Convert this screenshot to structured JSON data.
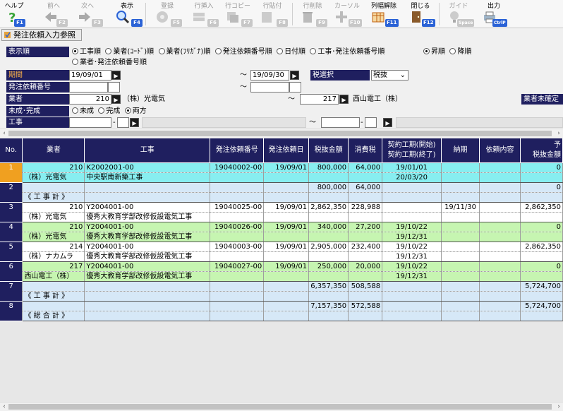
{
  "toolbar": {
    "buttons": [
      {
        "label": "ヘルプ",
        "key": "F1"
      },
      {
        "label": "前へ",
        "key": "F2"
      },
      {
        "label": "次へ",
        "key": "F3"
      },
      {
        "label": "表示",
        "key": "F4"
      },
      {
        "label": "登録",
        "key": "F5"
      },
      {
        "label": "行挿入",
        "key": "F6"
      },
      {
        "label": "行コピー",
        "key": "F7"
      },
      {
        "label": "行貼付",
        "key": "F8"
      },
      {
        "label": "行削除",
        "key": "F9"
      },
      {
        "label": "カーソル",
        "key": "F10"
      },
      {
        "label": "列幅解除",
        "key": "F11"
      },
      {
        "label": "閉じる",
        "key": "F12"
      },
      {
        "label": "ガイド",
        "key": "Space"
      },
      {
        "label": "出力",
        "key": "CtrlP"
      }
    ]
  },
  "title_tab": "発注依頼入力参照",
  "form": {
    "sort_label": "表示順",
    "sort_options": [
      "工事順",
      "業者(ｺｰﾄﾞ)順",
      "業者(ﾌﾘｶﾞﾅ)順",
      "発注依頼番号順",
      "日付順",
      "工事･発注依頼番号順",
      "業者･発注依頼番号順"
    ],
    "order_options": [
      "昇順",
      "降順"
    ],
    "period_label": "期間",
    "period_from": "19/09/01",
    "period_to": "19/09/30",
    "tilde": "～",
    "tax_label": "税選択",
    "tax_value": "税抜",
    "req_no_label": "発注依頼番号",
    "vendor_label": "業者",
    "vendor_from_code": "210",
    "vendor_from_name": "（株）光電気",
    "vendor_to_code": "217",
    "vendor_to_name": "西山電工（株）",
    "vendor_unconfirmed": "業者未確定",
    "status_label": "未成･完成",
    "status_options": [
      "未成",
      "完成",
      "両方"
    ],
    "work_label": "工事",
    "dash": "-"
  },
  "grid": {
    "headers": [
      "No.",
      "業者",
      "工事",
      "発注依頼番号",
      "発注依頼日",
      "税抜金額",
      "消費税",
      "契約工期(開始)",
      "契約工期(終了)",
      "納期",
      "依頼内容",
      "税抜金額",
      "予"
    ],
    "rows": [
      {
        "no": "1",
        "code": "210",
        "vendor": "（株）光電気",
        "work_code": "K2002001-00",
        "work_name": "中央駅南新築工事",
        "req_no": "19040002-00",
        "req_date": "19/09/01",
        "amount": "800,000",
        "tax": "64,000",
        "start": "19/01/01",
        "end": "20/03/20",
        "due": "",
        "content": "",
        "amount2": "0"
      },
      {
        "no": "2",
        "code": "",
        "vendor": "《 工 事 計 》",
        "work_code": "",
        "work_name": "",
        "req_no": "",
        "req_date": "",
        "amount": "800,000",
        "tax": "64,000",
        "start": "",
        "end": "",
        "due": "",
        "content": "",
        "amount2": "0"
      },
      {
        "no": "3",
        "code": "210",
        "vendor": "（株）光電気",
        "work_code": "Y2004001-00",
        "work_name": "優秀大教育学部改修仮設電気工事",
        "req_no": "19040025-00",
        "req_date": "19/09/01",
        "amount": "2,862,350",
        "tax": "228,988",
        "start": "",
        "end": "",
        "due": "19/11/30",
        "content": "",
        "amount2": "2,862,350"
      },
      {
        "no": "4",
        "code": "210",
        "vendor": "（株）光電気",
        "work_code": "Y2004001-00",
        "work_name": "優秀大教育学部改修仮設電気工事",
        "req_no": "19040026-00",
        "req_date": "19/09/01",
        "amount": "340,000",
        "tax": "27,200",
        "start": "19/10/22",
        "end": "19/12/31",
        "due": "",
        "content": "",
        "amount2": "0"
      },
      {
        "no": "5",
        "code": "214",
        "vendor": "（株）ナカムラ",
        "work_code": "Y2004001-00",
        "work_name": "優秀大教育学部改修仮設電気工事",
        "req_no": "19040003-00",
        "req_date": "19/09/01",
        "amount": "2,905,000",
        "tax": "232,400",
        "start": "19/10/22",
        "end": "19/12/31",
        "due": "",
        "content": "",
        "amount2": "2,862,350"
      },
      {
        "no": "6",
        "code": "217",
        "vendor": "西山電工（株）",
        "work_code": "Y2004001-00",
        "work_name": "優秀大教育学部改修仮設電気工事",
        "req_no": "19040027-00",
        "req_date": "19/09/01",
        "amount": "250,000",
        "tax": "20,000",
        "start": "19/10/22",
        "end": "19/12/31",
        "due": "",
        "content": "",
        "amount2": "0"
      },
      {
        "no": "7",
        "code": "",
        "vendor": "《 工 事 計 》",
        "work_code": "",
        "work_name": "",
        "req_no": "",
        "req_date": "",
        "amount": "6,357,350",
        "tax": "508,588",
        "start": "",
        "end": "",
        "due": "",
        "content": "",
        "amount2": "5,724,700"
      },
      {
        "no": "8",
        "code": "",
        "vendor": "《 総 合 計 》",
        "work_code": "",
        "work_name": "",
        "req_no": "",
        "req_date": "",
        "amount": "7,157,350",
        "tax": "572,588",
        "start": "",
        "end": "",
        "due": "",
        "content": "",
        "amount2": "5,724,700"
      }
    ]
  },
  "colors": {
    "header": "#1f1f5f",
    "cyan": "#87eef0",
    "blue": "#d6e8f7",
    "green": "#c6f5b1",
    "selected": "#f0a020"
  }
}
